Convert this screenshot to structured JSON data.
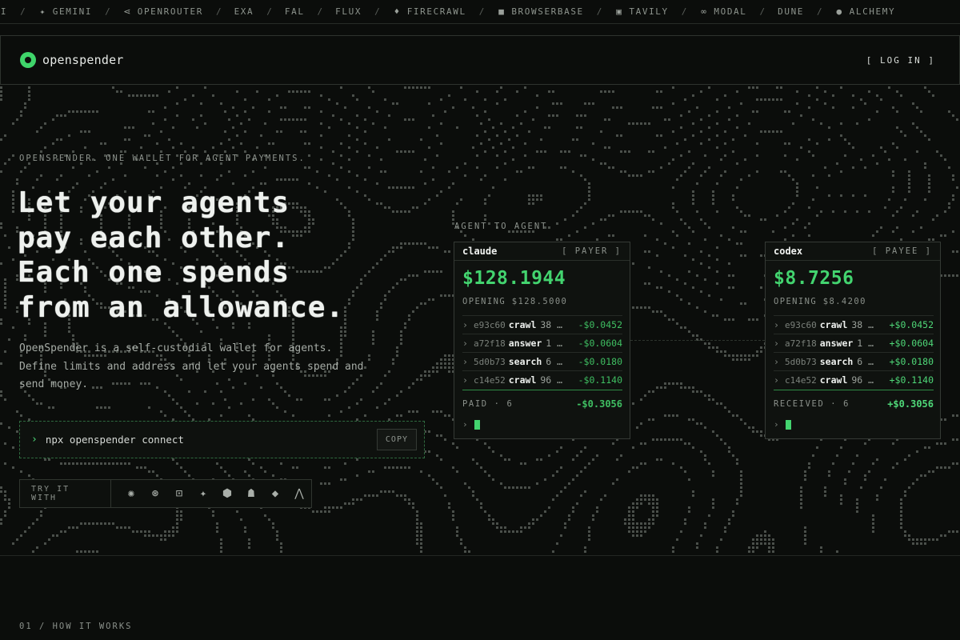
{
  "ticker": [
    {
      "label": "PENAI",
      "icon": ""
    },
    {
      "label": "GEMINI",
      "icon": "gemini-icon"
    },
    {
      "label": "OPENROUTER",
      "icon": "openrouter-icon"
    },
    {
      "label": "EXA",
      "icon": ""
    },
    {
      "label": "FAL",
      "icon": ""
    },
    {
      "label": "FLUX",
      "icon": ""
    },
    {
      "label": "FIRECRAWL",
      "icon": "flame-icon"
    },
    {
      "label": "BROWSERBASE",
      "icon": "square-icon"
    },
    {
      "label": "TAVILY",
      "icon": "tavily-icon"
    },
    {
      "label": "MODAL",
      "icon": "modal-icon"
    },
    {
      "label": "DUNE",
      "icon": ""
    },
    {
      "label": "ALCHEMY",
      "icon": "circle-icon"
    }
  ],
  "ticker_separator": "/",
  "nav": {
    "brand": "openspender",
    "login": "[ LOG IN ]"
  },
  "hero": {
    "eyebrow": "OPENSPENDER. ONE WALLET FOR AGENT PAYMENTS.",
    "headline": [
      "Let your agents",
      "pay each other.",
      "Each one spends",
      "from an allowance."
    ],
    "description": "OpenSpender is a self-custodial wallet for agents. Define limits and address and let your agents spend and send money.",
    "command_prompt": "›",
    "command": "npx openspender connect",
    "copy_label": "COPY",
    "try_label": "TRY IT WITH",
    "tools": [
      "claude-icon",
      "openai-icon",
      "terminal-icon",
      "gemini-icon",
      "cube-icon",
      "ghost-icon",
      "gem-icon",
      "vercel-icon"
    ]
  },
  "a2a": {
    "label": "AGENT TO AGENT",
    "payer": {
      "name": "claude",
      "role": "[ PAYER ]",
      "balance": "$128.1944",
      "opening": "OPENING $128.5000",
      "tx": [
        {
          "hash": "e93c60",
          "action": "crawl",
          "qty": "38 …",
          "amount": "-$0.0452"
        },
        {
          "hash": "a72f18",
          "action": "answer",
          "qty": "1 …",
          "amount": "-$0.0604"
        },
        {
          "hash": "5d0b73",
          "action": "search",
          "qty": "6 …",
          "amount": "-$0.0180"
        },
        {
          "hash": "c14e52",
          "action": "crawl",
          "qty": "96 …",
          "amount": "-$0.1140"
        }
      ],
      "total_label": "PAID · 6",
      "total": "-$0.3056"
    },
    "payee": {
      "name": "codex",
      "role": "[ PAYEE ]",
      "balance": "$8.7256",
      "opening": "OPENING $8.4200",
      "tx": [
        {
          "hash": "e93c60",
          "action": "crawl",
          "qty": "38 …",
          "amount": "+$0.0452"
        },
        {
          "hash": "a72f18",
          "action": "answer",
          "qty": "1 …",
          "amount": "+$0.0604"
        },
        {
          "hash": "5d0b73",
          "action": "search",
          "qty": "6 …",
          "amount": "+$0.0180"
        },
        {
          "hash": "c14e52",
          "action": "crawl",
          "qty": "96 …",
          "amount": "+$0.1140"
        }
      ],
      "total_label": "RECEIVED · 6",
      "total": "+$0.3056"
    }
  },
  "section": {
    "label": "01 / HOW IT WORKS"
  },
  "colors": {
    "accent": "#43d46f",
    "background": "#0b0d0b",
    "border": "#353a35"
  }
}
